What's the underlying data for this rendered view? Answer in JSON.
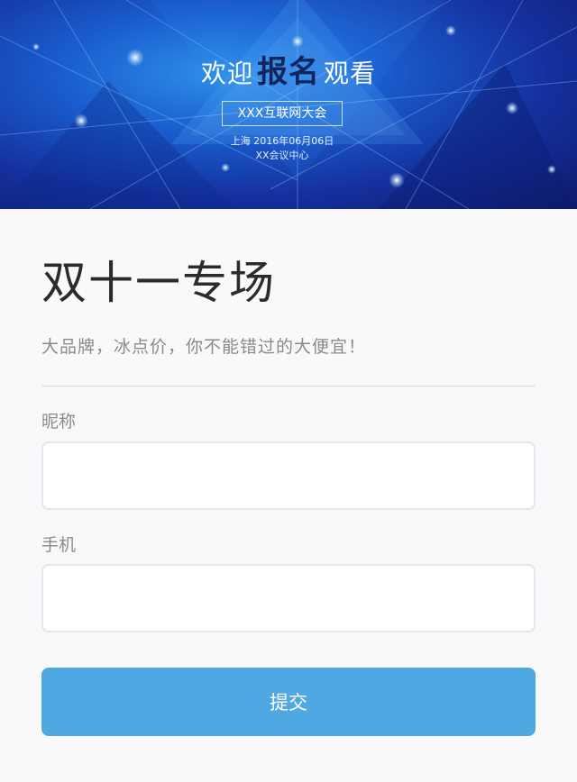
{
  "banner": {
    "welcome_prefix": "欢迎",
    "welcome_strong": "报名",
    "welcome_suffix": "观看",
    "event_name": "XXX互联网大会",
    "event_date": "上海 2016年06月06日",
    "event_venue": "XX会议中心"
  },
  "page": {
    "title": "双十一专场",
    "subtitle": "大品牌，冰点价，你不能错过的大便宜！"
  },
  "form": {
    "nickname_label": "昵称",
    "nickname_value": "",
    "phone_label": "手机",
    "phone_value": "",
    "submit_label": "提交"
  },
  "colors": {
    "accent": "#4fa8e2",
    "banner_dark": "#0e1a6a",
    "banner_light": "#2f8fe8"
  }
}
